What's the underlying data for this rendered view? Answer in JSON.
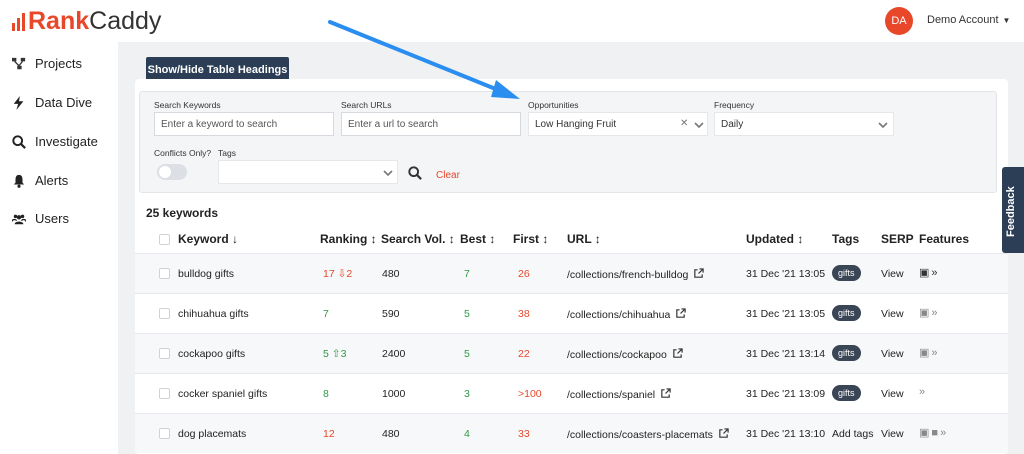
{
  "brand": {
    "name_part1": "Rank",
    "name_part2": "Caddy",
    "color": "#e8472a"
  },
  "account": {
    "initials": "DA",
    "name": "Demo Account"
  },
  "sidebar": {
    "items": [
      {
        "label": "Projects",
        "icon": "projects-icon"
      },
      {
        "label": "Data Dive",
        "icon": "bolt-icon"
      },
      {
        "label": "Investigate",
        "icon": "search-icon"
      },
      {
        "label": "Alerts",
        "icon": "bell-icon"
      },
      {
        "label": "Users",
        "icon": "users-icon"
      }
    ]
  },
  "toolbar": {
    "show_hide_label": "Show/Hide Table Headings"
  },
  "filters": {
    "search_keywords": {
      "label": "Search Keywords",
      "placeholder": "Enter a keyword to search"
    },
    "search_urls": {
      "label": "Search URLs",
      "placeholder": "Enter a url to search"
    },
    "opportunities": {
      "label": "Opportunities",
      "value": "Low Hanging Fruit"
    },
    "frequency": {
      "label": "Frequency",
      "value": "Daily"
    },
    "conflicts": {
      "label": "Conflicts Only?"
    },
    "tags": {
      "label": "Tags"
    },
    "clear_label": "Clear"
  },
  "table": {
    "count_label": "25 keywords",
    "headers": {
      "keyword": "Keyword ↓",
      "ranking": "Ranking ↕",
      "search_vol": "Search Vol. ↕",
      "best": "Best ↕",
      "first": "First ↕",
      "url": "URL ↕",
      "updated": "Updated ↕",
      "tags": "Tags",
      "serp": "SERP",
      "features": "Features"
    },
    "rows": [
      {
        "keyword": "bulldog gifts",
        "ranking": "17",
        "change": "⇩2",
        "search_vol": "480",
        "best": "7",
        "first": "26",
        "url": "/collections/french-bulldog",
        "updated": "31 Dec '21 13:05",
        "tag": "gifts",
        "serp": "View"
      },
      {
        "keyword": "chihuahua gifts",
        "ranking": "7",
        "change": "",
        "search_vol": "590",
        "best": "5",
        "first": "38",
        "url": "/collections/chihuahua",
        "updated": "31 Dec '21 13:05",
        "tag": "gifts",
        "serp": "View"
      },
      {
        "keyword": "cockapoo gifts",
        "ranking": "5",
        "change": "⇧3",
        "search_vol": "2400",
        "best": "5",
        "first": "22",
        "url": "/collections/cockapoo",
        "updated": "31 Dec '21 13:14",
        "tag": "gifts",
        "serp": "View"
      },
      {
        "keyword": "cocker spaniel gifts",
        "ranking": "8",
        "change": "",
        "search_vol": "1000",
        "best": "3",
        "first": ">100",
        "url": "/collections/spaniel",
        "updated": "31 Dec '21 13:09",
        "tag": "gifts",
        "serp": "View"
      },
      {
        "keyword": "dog placemats",
        "ranking": "12",
        "change": "",
        "search_vol": "480",
        "best": "4",
        "first": "33",
        "url": "/collections/coasters-placemats",
        "updated": "31 Dec '21 13:10",
        "tag": "Add tags",
        "serp": "View"
      }
    ]
  },
  "feedback": {
    "label": "Feedback"
  },
  "colors": {
    "accent": "#e8472a",
    "navy": "#2c3e55",
    "green": "#2e9a44",
    "arrow": "#2a8df0"
  }
}
